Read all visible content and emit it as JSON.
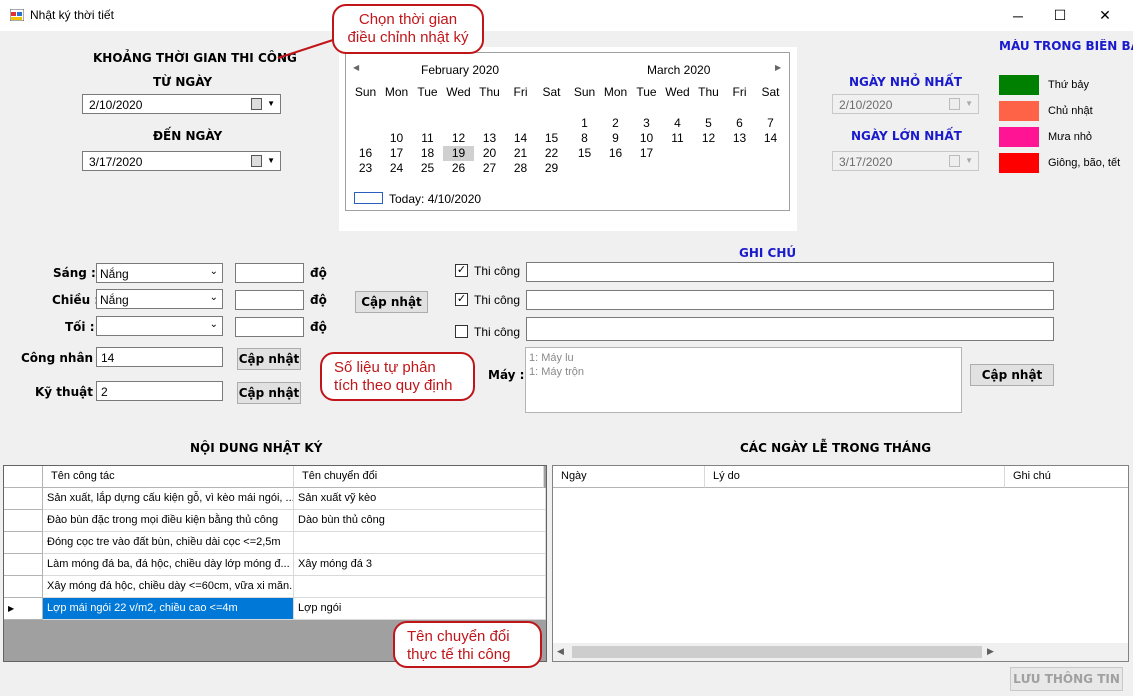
{
  "window": {
    "title": "Nhật ký thời tiết",
    "minimize": "─",
    "maximize": "☐",
    "close": "✕"
  },
  "period": {
    "heading": "KHOẢNG THỜI GIAN THI CÔNG",
    "from_label": "TỪ NGÀY",
    "from_value": "2/10/2020",
    "to_label": "ĐẾN NGÀY",
    "to_value": "3/17/2020"
  },
  "callouts": {
    "time": "Chọn thời gian\nđiều chỉnh nhật ký",
    "stats": "Số liệu tự phân\ntích theo quy định",
    "convert": "Tên chuyển đổi\nthực tế thi công"
  },
  "calendar": {
    "months": [
      {
        "title": "February 2020",
        "weeks": [
          [
            "",
            "",
            "",
            "",
            "",
            "",
            ""
          ],
          [
            "",
            "10",
            "11",
            "12",
            "13",
            "14",
            "15"
          ],
          [
            "16",
            "17",
            "18",
            "19",
            "20",
            "21",
            "22"
          ],
          [
            "23",
            "24",
            "25",
            "26",
            "27",
            "28",
            "29"
          ]
        ]
      },
      {
        "title": "March 2020",
        "weeks": [
          [
            "1",
            "2",
            "3",
            "4",
            "5",
            "6",
            "7"
          ],
          [
            "8",
            "9",
            "10",
            "11",
            "12",
            "13",
            "14"
          ],
          [
            "15",
            "16",
            "17",
            "",
            "",
            "",
            ""
          ]
        ]
      }
    ],
    "dows": [
      "Sun",
      "Mon",
      "Tue",
      "Wed",
      "Thu",
      "Fri",
      "Sat"
    ],
    "selected": "19",
    "today": "Today: 4/10/2020",
    "prev": "◀",
    "next": "▶"
  },
  "range": {
    "min_label": "NGÀY NHỎ NHẤT",
    "min_value": "2/10/2020",
    "max_label": "NGÀY LỚN NHẤT",
    "max_value": "3/17/2020"
  },
  "legend": {
    "title": "MÀU TRONG BIÊN BẢ",
    "items": [
      {
        "label": "Thứ bảy",
        "color": "#008000"
      },
      {
        "label": "Chủ nhật",
        "color": "#ff6347"
      },
      {
        "label": "Mưa nhỏ",
        "color": "#ff1493"
      },
      {
        "label": "Giông, bão, tết",
        "color": "#ff0000"
      }
    ]
  },
  "weather": {
    "morning_label": "Sáng :",
    "morning_value": "Nắng",
    "afternoon_label": "Chiều :",
    "afternoon_value": "Nắng",
    "night_label": "Tối :",
    "night_value": "",
    "unit": "độ",
    "update": "Cập nhật"
  },
  "workers": {
    "label": "Công nhân :",
    "value": "14",
    "update": "Cập nhật"
  },
  "tech": {
    "label": "Kỹ thuật :",
    "value": "2",
    "update": "Cập nhật"
  },
  "notes": {
    "heading": "GHI CHÚ",
    "rows": [
      {
        "label": "Thi công",
        "checked": true
      },
      {
        "label": "Thi công",
        "checked": true
      },
      {
        "label": "Thi công",
        "checked": false
      }
    ]
  },
  "machine": {
    "label": "Máy :",
    "lines": [
      "1: Máy lu",
      "1: Máy trộn"
    ],
    "update": "Cập nhật"
  },
  "diary": {
    "heading": "NỘI DUNG NHẬT KÝ",
    "columns": [
      "Tên công tác",
      "Tên chuyển đổi"
    ],
    "rows": [
      [
        "Sản xuất, lắp dựng cấu kiện gỗ, vì kèo mái ngói, ...",
        "Sản xuất vỹ kèo"
      ],
      [
        "Đào bùn đặc trong mọi điều kiện bằng thủ công",
        "Dào bùn thủ công"
      ],
      [
        "Đóng cọc tre vào đất bùn, chiều dài cọc <=2,5m",
        ""
      ],
      [
        "Làm móng đá ba, đá hộc, chiều dày lớp móng đ...",
        "Xây móng đá 3"
      ],
      [
        "Xây móng đá hộc, chiều dày <=60cm, vữa xi măn...",
        ""
      ],
      [
        "Lợp mái ngói 22 v/m2, chiều cao <=4m",
        "Lợp ngói"
      ]
    ]
  },
  "holidays": {
    "heading": "CÁC NGÀY LỄ TRONG THÁNG",
    "columns": [
      "Ngày",
      "Lý do",
      "Ghi chú"
    ]
  },
  "save": "LƯU THÔNG TIN"
}
